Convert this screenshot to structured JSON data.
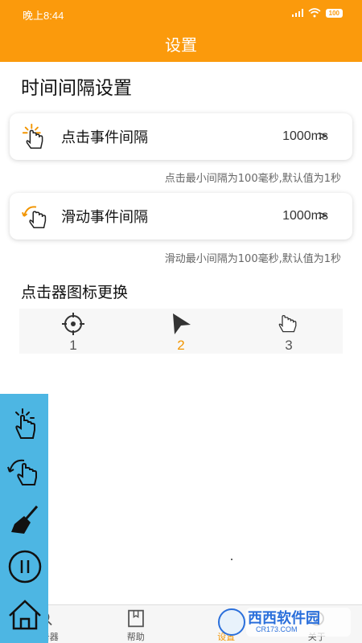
{
  "status": {
    "time": "晚上8:44",
    "battery": "100"
  },
  "header": {
    "title": "设置"
  },
  "interval_section": {
    "title": "时间间隔设置",
    "click": {
      "label": "点击事件间隔",
      "value": "1000ms",
      "hint": "点击最小间隔为100毫秒,默认值为1秒"
    },
    "swipe": {
      "label": "滑动事件间隔",
      "value": "1000ms",
      "hint": "滑动最小间隔为100毫秒,默认值为1秒"
    }
  },
  "icon_section": {
    "title": "点击器图标更换",
    "options": [
      {
        "num": "1",
        "icon": "crosshair-icon"
      },
      {
        "num": "2",
        "icon": "arrow-pointer-icon",
        "selected": true
      },
      {
        "num": "3",
        "icon": "hand-pointer-icon"
      }
    ]
  },
  "floating_panel": [
    "tap-hand-icon",
    "swipe-hand-icon",
    "broom-icon",
    "pause-icon",
    "home-icon"
  ],
  "bottom_nav": [
    {
      "label": "点击器"
    },
    {
      "label": "帮助"
    },
    {
      "label": "设置",
      "active": true
    },
    {
      "label": "关于"
    }
  ],
  "watermark": {
    "title": "西西软件园",
    "sub": "CR173.COM"
  },
  "colors": {
    "accent": "#fb9a0c",
    "panel": "#4db6e3",
    "selected": "#f29500"
  }
}
